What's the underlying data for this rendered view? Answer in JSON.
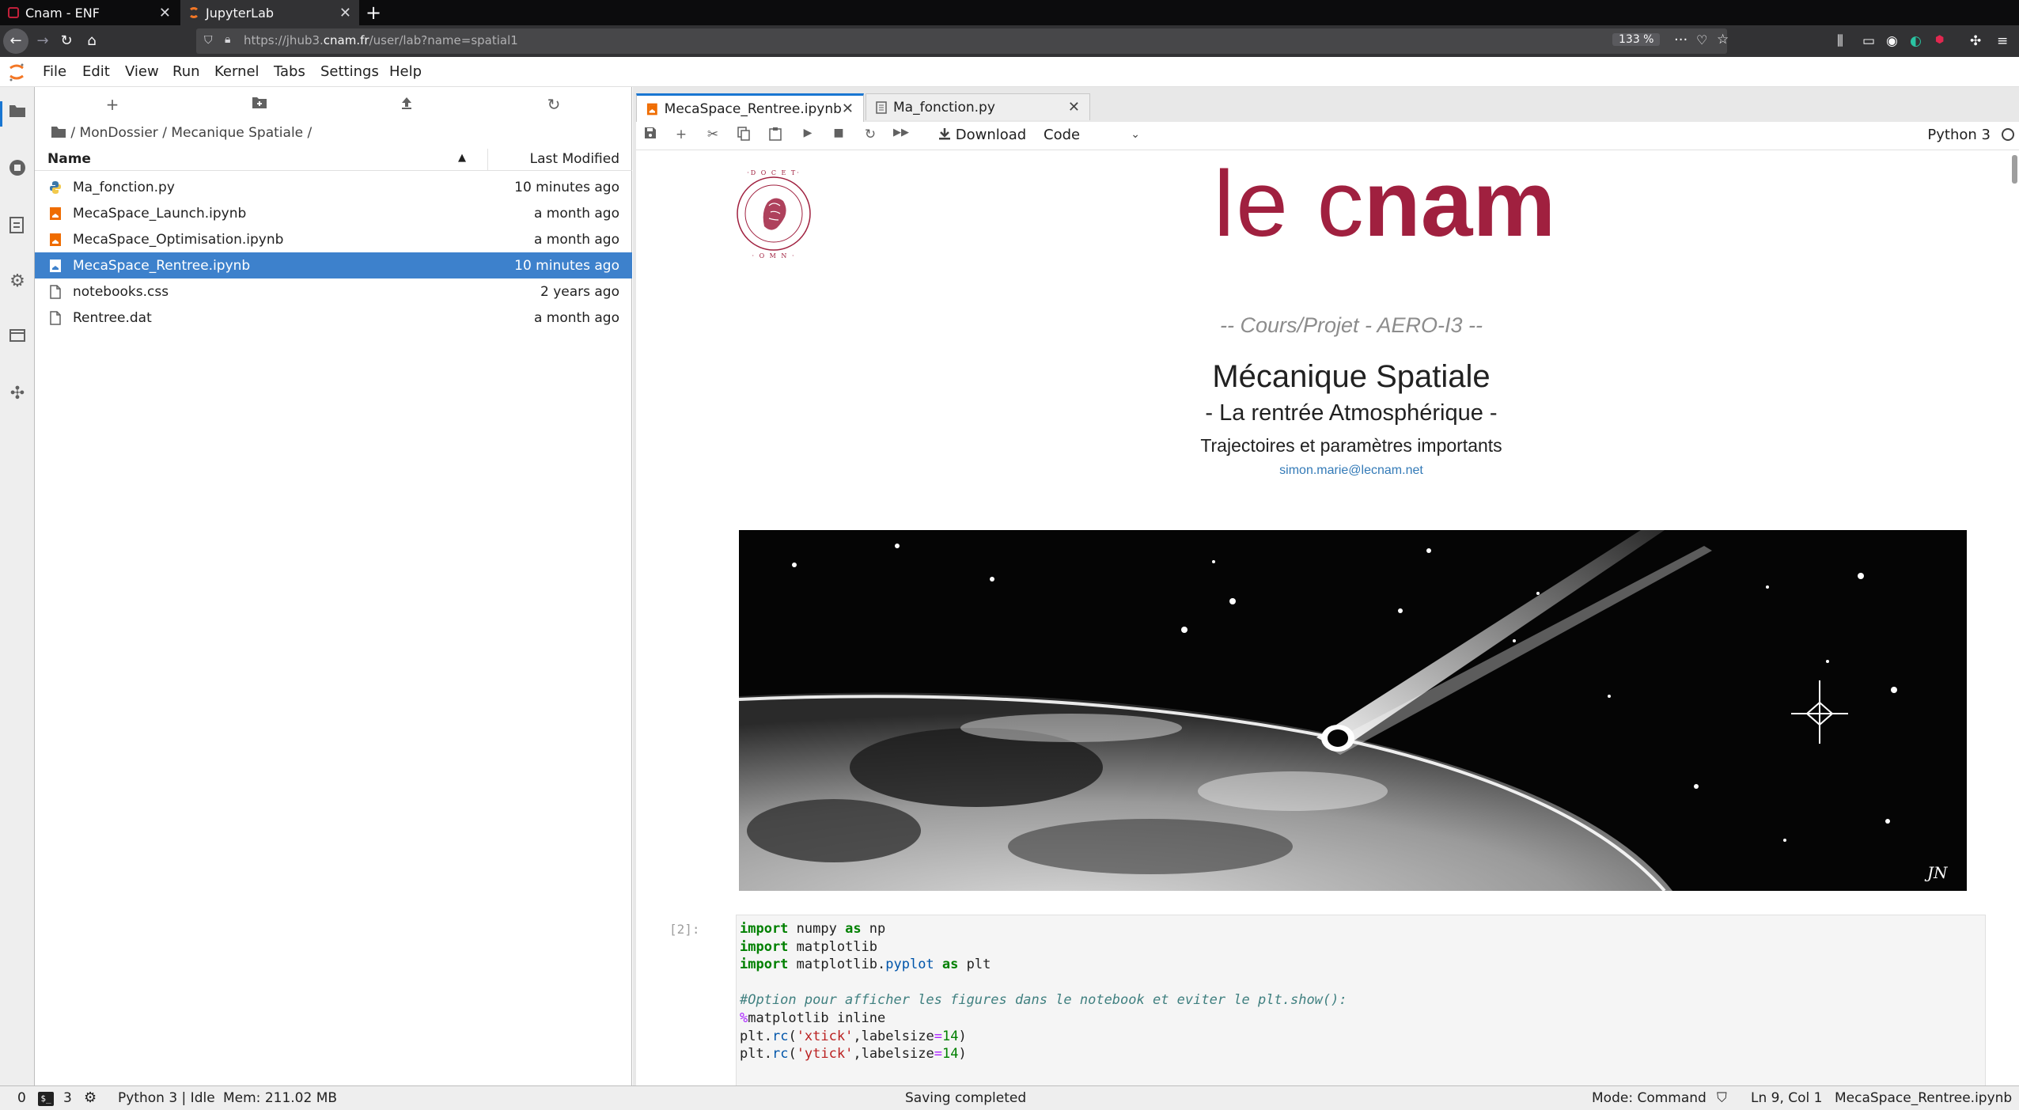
{
  "browser": {
    "tabs": [
      {
        "title": "Cnam - ENF",
        "active": false
      },
      {
        "title": "JupyterLab",
        "active": true
      }
    ],
    "url_prefix": "https://jhub3.",
    "url_domain": "cnam.fr",
    "url_path": "/user/lab?name=spatial1",
    "zoom": "133 %"
  },
  "menubar": {
    "items": [
      "File",
      "Edit",
      "View",
      "Run",
      "Kernel",
      "Tabs",
      "Settings",
      "Help"
    ]
  },
  "filebrowser": {
    "breadcrumb": {
      "root": "/",
      "folder1": "MonDossier",
      "sep": "/",
      "folder2": "Mecanique Spatiale",
      "end": "/"
    },
    "columns": {
      "name": "Name",
      "modified": "Last Modified"
    },
    "files": [
      {
        "name": "Ma_fonction.py",
        "modified": "10 minutes ago",
        "type": "python",
        "selected": false
      },
      {
        "name": "MecaSpace_Launch.ipynb",
        "modified": "a month ago",
        "type": "notebook",
        "selected": false
      },
      {
        "name": "MecaSpace_Optimisation.ipynb",
        "modified": "a month ago",
        "type": "notebook",
        "selected": false
      },
      {
        "name": "MecaSpace_Rentree.ipynb",
        "modified": "10 minutes ago",
        "type": "notebook",
        "selected": true
      },
      {
        "name": "notebooks.css",
        "modified": "2 years ago",
        "type": "file",
        "selected": false
      },
      {
        "name": "Rentree.dat",
        "modified": "a month ago",
        "type": "file",
        "selected": false
      }
    ]
  },
  "doc_tabs": [
    {
      "title": "MecaSpace_Rentree.ipynb",
      "active": true
    },
    {
      "title": "Ma_fonction.py",
      "active": false
    }
  ],
  "nb_toolbar": {
    "download_label": "Download",
    "cell_type": "Code",
    "kernel": "Python 3"
  },
  "notebook": {
    "logo": {
      "le": "le ",
      "c": "c",
      "nam": "nam"
    },
    "course": "-- Cours/Projet - AERO-I3 --",
    "title": "Mécanique Spatiale",
    "subtitle": "- La rentrée Atmosphérique -",
    "topic": "Trajectoires et paramètres importants",
    "email": "simon.marie@lecnam.net",
    "image_signature": "JN",
    "cell_prompt": "[2]:"
  },
  "statusbar": {
    "count_a": "0",
    "count_b": "3",
    "kernel_status": "Python 3 | Idle",
    "memory": "Mem: 211.02 MB",
    "message": "Saving completed",
    "mode": "Mode: Command",
    "position": "Ln 9, Col 1",
    "file": "MecaSpace_Rentree.ipynb"
  },
  "colors": {
    "accent": "#1976d2",
    "selection": "#3d81cc",
    "cnam_red": "#a0203f"
  }
}
